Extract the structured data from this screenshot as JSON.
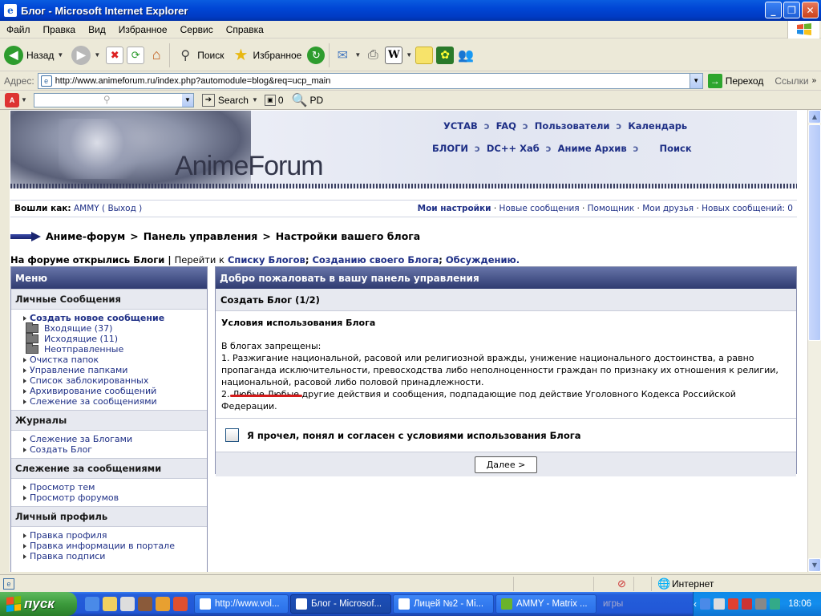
{
  "window": {
    "title": "Блог - Microsoft Internet Explorer"
  },
  "menu": [
    "Файл",
    "Правка",
    "Вид",
    "Избранное",
    "Сервис",
    "Справка"
  ],
  "toolbar": {
    "back": "Назад",
    "search": "Поиск",
    "favorites": "Избранное"
  },
  "address": {
    "label": "Адрес:",
    "url": "http://www.animeforum.ru/index.php?automodule=blog&req=ucp_main",
    "go": "Переход",
    "links": "Ссылки"
  },
  "searchbar": {
    "search": "Search",
    "count": "0",
    "pd": "PD"
  },
  "banner": {
    "logo": "AnimeForum",
    "nav1": [
      "УСТАВ",
      "FAQ",
      "Пользователи",
      "Календарь"
    ],
    "nav2": [
      "БЛОГИ",
      "DC++ Хаб",
      "Аниме Архив",
      "Поиск"
    ]
  },
  "userbar": {
    "logged_as": "Вошли как:",
    "user": "AMMY",
    "logout": "( Выход )",
    "links": [
      "Мои настройки",
      "Новые сообщения",
      "Помощник",
      "Мои друзья",
      "Новых сообщений: 0"
    ]
  },
  "breadcrumb": [
    "Аниме-форум",
    "Панель управления",
    "Настройки вашего блога"
  ],
  "announce": {
    "pre": "На форуме открылись Блоги",
    "mid": "Перейти к",
    "l1": "Списку Блогов",
    "l2": "Созданию своего Блога",
    "l3": "Обсуждению."
  },
  "sidebar": {
    "title": "Меню",
    "sections": [
      {
        "title": "Личные Сообщения",
        "items": [
          "Создать новое сообщение",
          "Входящие (37)",
          "Исходящие (11)",
          "Неотправленные",
          "Очистка папок",
          "Управление папками",
          "Список заблокированных",
          "Архивирование сообщений",
          "Слежение за сообщениями"
        ]
      },
      {
        "title": "Журналы",
        "items": [
          "Слежение за Блогами",
          "Создать Блог"
        ]
      },
      {
        "title": "Слежение за сообщениями",
        "items": [
          "Просмотр тем",
          "Просмотр форумов"
        ]
      },
      {
        "title": "Личный профиль",
        "items": [
          "Правка профиля",
          "Правка информации в портале",
          "Правка подписи"
        ]
      }
    ]
  },
  "main": {
    "title": "Добро пожаловать в вашу панель управления",
    "subtitle": "Создать Блог (1/2)",
    "heading": "Условия использования Блога",
    "intro": "В блогах запрещены:",
    "rule1": "1. Разжигание национальной, расовой или религиозной вражды, унижение национального достоинства, а равно пропаганда исключительности, превосходства либо неполноценности граждан по признаку их отношения к религии, национальной, расовой либо половой принадлежности.",
    "rule2_num": "2. ",
    "rule2_hl": "Любые Любые",
    "rule2_rest": " другие действия и сообщения, подпадающие под действие Уголовного Кодекса Российской Федерации.",
    "agree": "Я прочел, понял и согласен с условиями использования Блога",
    "next": "Далее >"
  },
  "status": {
    "zone": "Интернет"
  },
  "taskbar": {
    "start": "пуск",
    "tasks": [
      "http://www.vol...",
      "Блог - Microsof...",
      "Лицей №2 - Mi...",
      "AMMY - Matrix ..."
    ],
    "games": "игры",
    "clock": "18:06"
  }
}
